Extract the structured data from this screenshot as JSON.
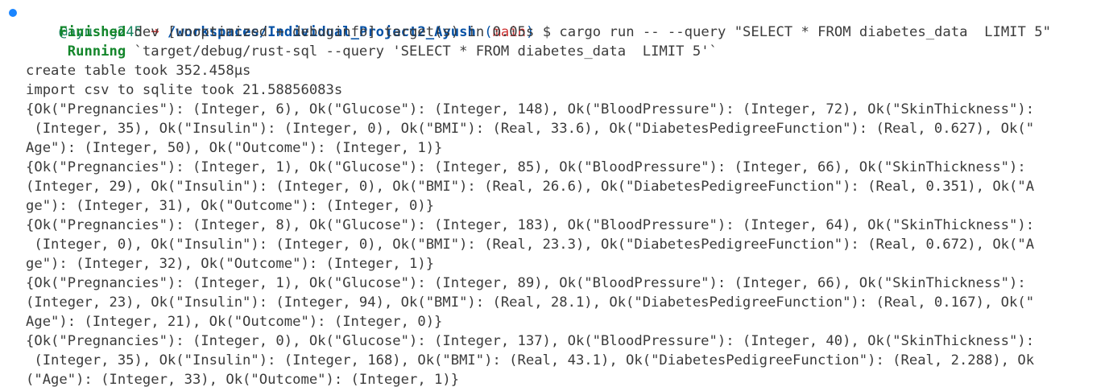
{
  "prompt": {
    "user": "@ayushg245",
    "arrow": "➜",
    "path": "/workspaces/Individual_Project2_Ayush",
    "branch_open": "(",
    "branch": "main",
    "branch_close": ")",
    "symbol": "$",
    "command": "cargo run -- --query \"SELECT * FROM diabetes_data  LIMIT 5\""
  },
  "cargo": {
    "finished_label": "Finished",
    "finished_text": "dev [unoptimized + debuginfo] target(s) in 0.05s",
    "running_label": "Running",
    "running_text": "`target/debug/rust-sql --query 'SELECT * FROM diabetes_data  LIMIT 5'`"
  },
  "output": [
    "create table took 352.458µs",
    "import csv to sqlite took 21.58856083s",
    "{Ok(\"Pregnancies\"): (Integer, 6), Ok(\"Glucose\"): (Integer, 148), Ok(\"BloodPressure\"): (Integer, 72), Ok(\"SkinThickness\"):",
    " (Integer, 35), Ok(\"Insulin\"): (Integer, 0), Ok(\"BMI\"): (Real, 33.6), Ok(\"DiabetesPedigreeFunction\"): (Real, 0.627), Ok(\"",
    "Age\"): (Integer, 50), Ok(\"Outcome\"): (Integer, 1)}",
    "{Ok(\"Pregnancies\"): (Integer, 1), Ok(\"Glucose\"): (Integer, 85), Ok(\"BloodPressure\"): (Integer, 66), Ok(\"SkinThickness\"):",
    "(Integer, 29), Ok(\"Insulin\"): (Integer, 0), Ok(\"BMI\"): (Real, 26.6), Ok(\"DiabetesPedigreeFunction\"): (Real, 0.351), Ok(\"A",
    "ge\"): (Integer, 31), Ok(\"Outcome\"): (Integer, 0)}",
    "{Ok(\"Pregnancies\"): (Integer, 8), Ok(\"Glucose\"): (Integer, 183), Ok(\"BloodPressure\"): (Integer, 64), Ok(\"SkinThickness\"):",
    " (Integer, 0), Ok(\"Insulin\"): (Integer, 0), Ok(\"BMI\"): (Real, 23.3), Ok(\"DiabetesPedigreeFunction\"): (Real, 0.672), Ok(\"A",
    "ge\"): (Integer, 32), Ok(\"Outcome\"): (Integer, 1)}",
    "{Ok(\"Pregnancies\"): (Integer, 1), Ok(\"Glucose\"): (Integer, 89), Ok(\"BloodPressure\"): (Integer, 66), Ok(\"SkinThickness\"):",
    "(Integer, 23), Ok(\"Insulin\"): (Integer, 94), Ok(\"BMI\"): (Real, 28.1), Ok(\"DiabetesPedigreeFunction\"): (Real, 0.167), Ok(\"",
    "Age\"): (Integer, 21), Ok(\"Outcome\"): (Integer, 0)}",
    "{Ok(\"Pregnancies\"): (Integer, 0), Ok(\"Glucose\"): (Integer, 137), Ok(\"BloodPressure\"): (Integer, 40), Ok(\"SkinThickness\"):",
    " (Integer, 35), Ok(\"Insulin\"): (Integer, 168), Ok(\"BMI\"): (Real, 43.1), Ok(\"DiabetesPedigreeFunction\"): (Real, 2.288), Ok",
    "(\"Age\"): (Integer, 33), Ok(\"Outcome\"): (Integer, 1)}"
  ],
  "colors": {
    "background": "#ffffff",
    "text": "#3b3b3b",
    "user": "#16825d",
    "arrow": "#cd3131",
    "path": "#0451a5",
    "branch": "#cd3131",
    "status": "#14862b",
    "decoration_dot": "#1a85ff"
  }
}
